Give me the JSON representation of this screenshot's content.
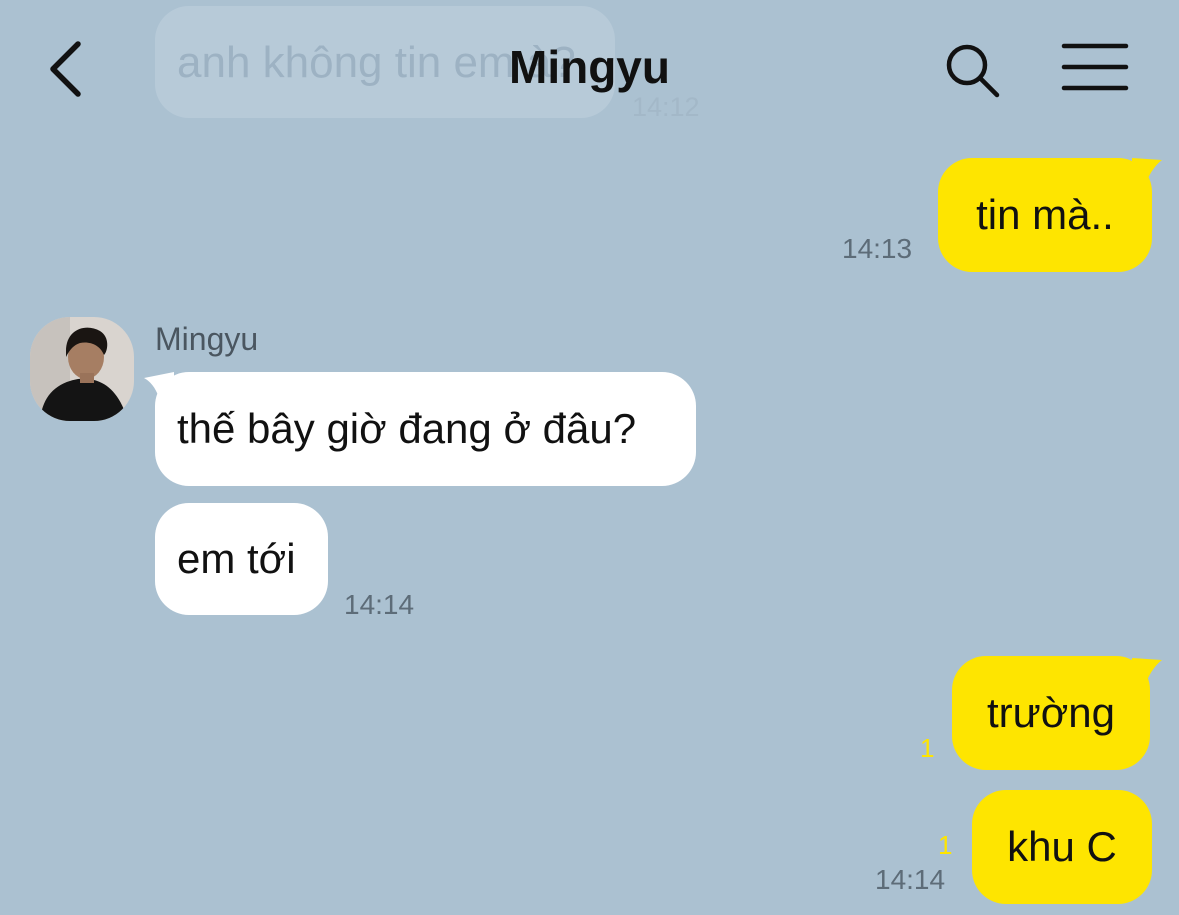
{
  "header": {
    "title": "Mingyu"
  },
  "ghost_message": {
    "text": "anh không tin em à?",
    "time": "14:12"
  },
  "messages": [
    {
      "direction": "out",
      "text": "tin mà..",
      "time": "14:13"
    },
    {
      "direction": "in",
      "sender": "Mingyu",
      "text": "thế bây giờ đang ở đâu?"
    },
    {
      "direction": "in",
      "text": "em tới",
      "time": "14:14"
    },
    {
      "direction": "out",
      "text": "trường",
      "unread": "1"
    },
    {
      "direction": "out",
      "text": "khu C",
      "unread": "1",
      "time": "14:14"
    }
  ],
  "icons": {
    "back": "chevron-left-icon",
    "search": "search-icon",
    "menu": "hamburger-menu-icon"
  },
  "colors": {
    "background": "#abc1d1",
    "outgoing_bubble": "#fee500",
    "incoming_bubble": "#ffffff",
    "unread_count": "#fee500"
  }
}
